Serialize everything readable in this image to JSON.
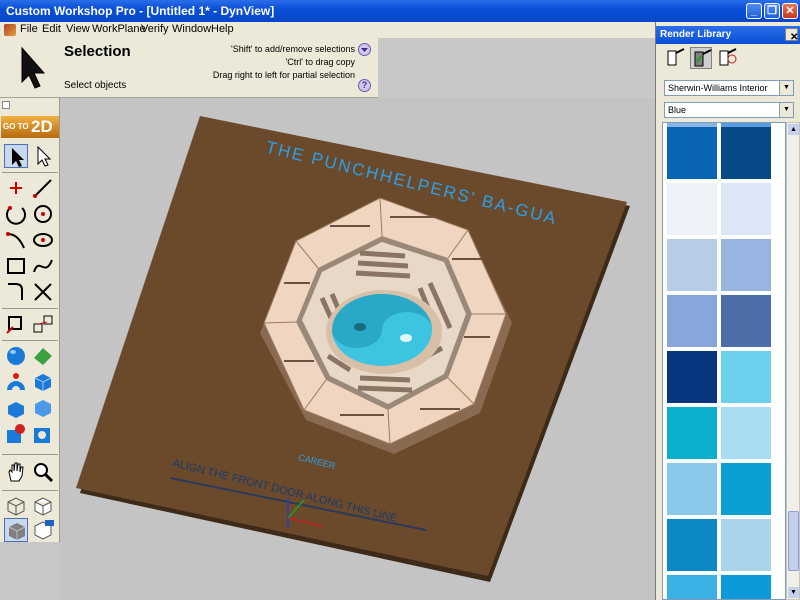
{
  "window": {
    "title": "Custom Workshop Pro - [Untitled 1* - DynView]",
    "min_label": "_",
    "max_label": "❐",
    "close_label": "✕"
  },
  "menu": {
    "items": [
      "File",
      "Edit",
      "View",
      "WorkPlane",
      "Verify",
      "Window",
      "Help"
    ]
  },
  "selection_panel": {
    "title": "Selection",
    "subtitle": "Select objects",
    "hints": [
      "'Shift' to add/remove selections",
      "'Ctrl' to drag copy",
      "Drag right to left for partial selection"
    ],
    "hint_more_icon": "chevron-down-icon",
    "help_label": "?"
  },
  "toolbar": {
    "goto_label_small": "GO TO",
    "goto_label_big": "2D"
  },
  "viewport": {
    "plaque_title": "THE PUNCHHELPERS' BA-GUA",
    "align_text": "ALIGN THE FRONT DOOR ALONG THIS LINE",
    "board_color": "#6b4a2b",
    "text_color": "#2aa0e8",
    "yin_yang_color": "#3cc4e0",
    "octagon_outer": "#f0d6c0",
    "octagon_inner": "#e8d8c8",
    "bottom_label": "CAREER"
  },
  "render_library": {
    "title": "Render Library",
    "close_label": "✕",
    "palette_dropdown": "Sherwin-Williams Interior",
    "color_dropdown": "Blue",
    "swatches": [
      "#8ab4e4",
      "#5a9ae0",
      "#0a64b4",
      "#064a88",
      "#eef2f8",
      "#dce6f6",
      "#b8cce8",
      "#98b4e0",
      "#86a6dc",
      "#4e6eaa",
      "#06367e",
      "#6ad0ec",
      "#08b0cc",
      "#a8dcf2",
      "#8ac8ec",
      "#0aa0d4",
      "#0c88c4",
      "#a8d4ec",
      "#3ab0e4",
      "#0c9ad8"
    ]
  }
}
